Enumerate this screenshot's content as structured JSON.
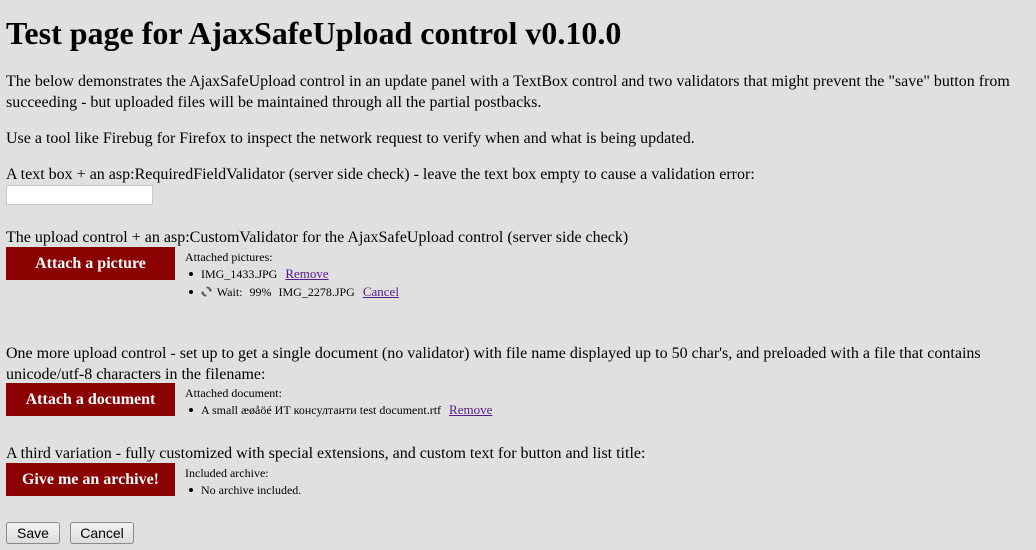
{
  "page": {
    "title": "Test page for AjaxSafeUpload control v0.10.0",
    "intro": "The below demonstrates the AjaxSafeUpload control in an update panel with a TextBox control and two validators that might prevent the \"save\" button from succeeding - but uploaded files will be maintained through all the partial postbacks.",
    "firebug_note": "Use a tool like Firebug for Firefox to inspect the network request to verify when and what is being updated.",
    "textbox_label": "A text box + an asp:RequiredFieldValidator (server side check) - leave the text box empty to cause a validation error:",
    "textbox_value": ""
  },
  "upload_picture": {
    "label": "The upload control + an asp:CustomValidator for the AjaxSafeUpload control (server side check)",
    "button_label": "Attach a picture",
    "list_title": "Attached pictures:",
    "files": [
      {
        "name": "IMG_1433.JPG",
        "action": "Remove"
      }
    ],
    "pending": {
      "icon": "refresh-spinner-icon",
      "status": "Wait:",
      "progress": "99%",
      "name": "IMG_2278.JPG",
      "action": "Cancel"
    }
  },
  "upload_document": {
    "label": "One more upload control - set up to get a single document (no validator) with file name displayed up to 50 char's, and preloaded with a file that contains unicode/utf-8 characters in the filename:",
    "button_label": "Attach a document",
    "list_title": "Attached document:",
    "files": [
      {
        "name": "A small æøåöé ИТ консултанти test document.rtf",
        "action": "Remove"
      }
    ]
  },
  "upload_archive": {
    "label": "A third variation - fully customized with special extensions, and custom text for button and list title:",
    "button_label": "Give me an archive!",
    "list_title": "Included archive:",
    "empty_text": "No archive included."
  },
  "form": {
    "save_label": "Save",
    "cancel_label": "Cancel"
  },
  "colors": {
    "background": "#e0e0e0",
    "upload_button": "#8b0000",
    "link": "#551a8b"
  }
}
